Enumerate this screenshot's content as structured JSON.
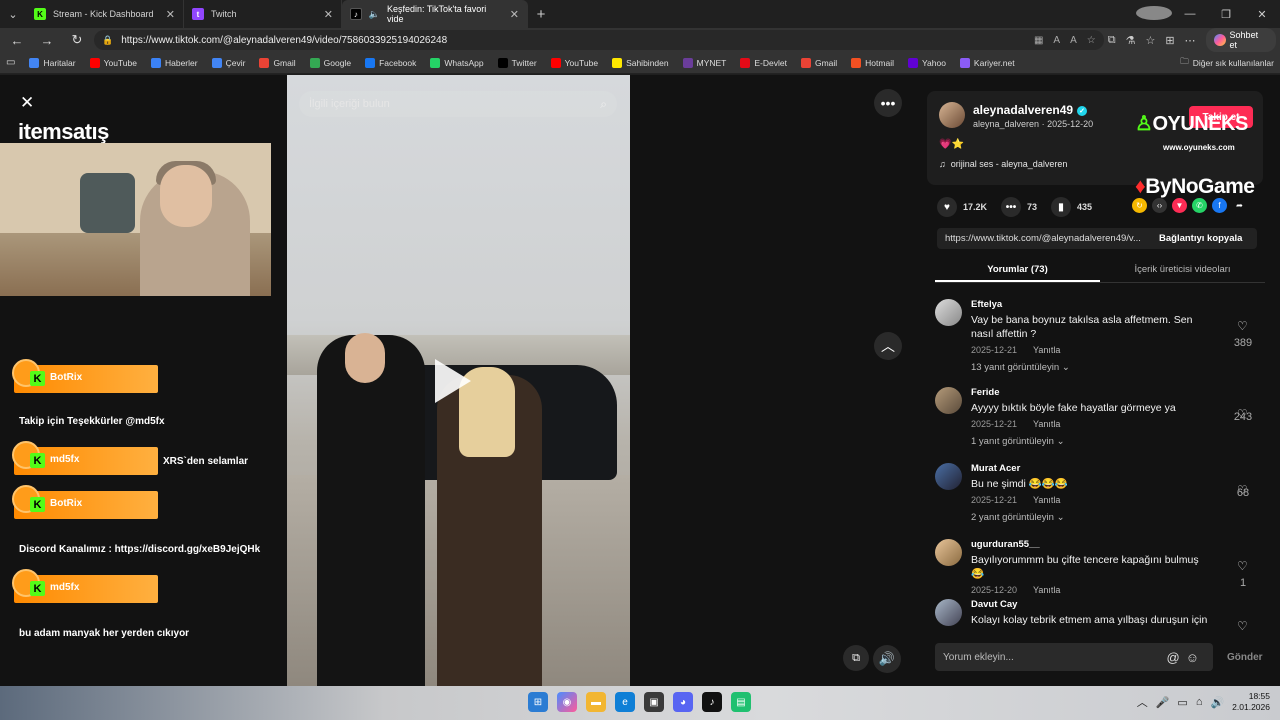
{
  "browser": {
    "tabs": [
      {
        "title": "Stream - Kick Dashboard",
        "favicon": "kick-icon",
        "active": false
      },
      {
        "title": "Twitch",
        "favicon": "twitch-icon",
        "active": false
      },
      {
        "title": "Keşfedin: TikTok'ta favori vide",
        "favicon": "tiktok-icon",
        "active": true
      }
    ],
    "url": "https://www.tiktok.com/@aleynadalveren49/video/7586033925194026248",
    "copilot_label": "Sohbet et",
    "bookmarks": [
      {
        "label": "Haritalar",
        "color": "#4285f4"
      },
      {
        "label": "YouTube",
        "color": "#ff0000"
      },
      {
        "label": "Haberler",
        "color": "#3b82f6"
      },
      {
        "label": "Çevir",
        "color": "#4285f4"
      },
      {
        "label": "Gmail",
        "color": "#ea4335"
      },
      {
        "label": "Google",
        "color": "#34a853"
      },
      {
        "label": "Facebook",
        "color": "#1877f2"
      },
      {
        "label": "WhatsApp",
        "color": "#25d366"
      },
      {
        "label": "Twitter",
        "color": "#000000"
      },
      {
        "label": "YouTube",
        "color": "#ff0000"
      },
      {
        "label": "Sahibinden",
        "color": "#ffe800"
      },
      {
        "label": "MYNET",
        "color": "#6a3d9a"
      },
      {
        "label": "E-Devlet",
        "color": "#e30a17"
      },
      {
        "label": "Gmail",
        "color": "#ea4335"
      },
      {
        "label": "Hotmail",
        "color": "#f25022"
      },
      {
        "label": "Yahoo",
        "color": "#6001d2"
      },
      {
        "label": "Kariyer.net",
        "color": "#8b5cf6"
      }
    ],
    "other_bookmarks": "Diğer sık kullanılanlar"
  },
  "overlay": {
    "brand": "itemsatış",
    "chat": [
      {
        "type": "badge",
        "name": "BotRix"
      },
      {
        "type": "msg",
        "text": "Takip için Teşekkürler @md5fx"
      },
      {
        "type": "badge",
        "name": "md5fx",
        "text": "XRS`den selamlar"
      },
      {
        "type": "badge",
        "name": "BotRix"
      },
      {
        "type": "msg",
        "text": "Discord Kanalımız : https://discord.gg/xeB9JejQHk"
      },
      {
        "type": "badge",
        "name": "md5fx"
      },
      {
        "type": "msg",
        "text": "bu adam manyak her yerden cıkıyor"
      }
    ],
    "sponsors": {
      "oyuneks": "OYUNEKS",
      "oyuneks_url": "www.oyuneks.com",
      "bynogame": "ByNoGame"
    }
  },
  "video": {
    "search_placeholder": "İlgili içeriği bulun"
  },
  "author": {
    "username": "aleynadalveren49",
    "handle": "aleyna_dalveren",
    "date": "2025-12-20",
    "caption": "💗⭐",
    "sound": "orijinal ses - aleyna_dalveren",
    "follow_label": "Takip et"
  },
  "stats": {
    "likes": "17.2K",
    "comments": "73",
    "saves": "435"
  },
  "link": {
    "url": "https://www.tiktok.com/@aleynadalveren49/v...",
    "copy_label": "Bağlantıyı kopyala"
  },
  "tabs": {
    "comments": "Yorumlar (73)",
    "creator": "İçerik üreticisi videoları"
  },
  "comments": [
    {
      "user": "Eftelya",
      "text": "Vay be bana boynuz takılsa asla affetmem. Sen nasıl affettin ?",
      "date": "2025-12-21",
      "reply": "Yanıtla",
      "likes": "389",
      "replies": "13 yanıt görüntüleyin"
    },
    {
      "user": "Feride",
      "text": "Ayyyy bıktık böyle fake hayatlar görmeye ya",
      "date": "2025-12-21",
      "reply": "Yanıtla",
      "likes": "243",
      "replies": "1 yanıt görüntüleyin"
    },
    {
      "user": "Murat Acer",
      "text": "Bu ne şimdi 😂😂😂",
      "date": "2025-12-21",
      "reply": "Yanıtla",
      "likes": "68",
      "replies": "2 yanıt görüntüleyin"
    },
    {
      "user": "ugurduran55__",
      "text": "Bayılıyorummm bu çifte tencere kapağını bulmuş 😂",
      "date": "2025-12-20",
      "reply": "Yanıtla",
      "likes": "1",
      "replies": ""
    },
    {
      "user": "Davut Cay",
      "text": "Kolayı kolay tebrik etmem ama yılbaşı duruşun için",
      "date": "",
      "reply": "",
      "likes": "",
      "replies": ""
    }
  ],
  "comment_box": {
    "placeholder": "Yorum ekleyin...",
    "send_label": "Gönder"
  },
  "taskbar": {
    "time": "18:55",
    "date": "2.01.2026"
  }
}
